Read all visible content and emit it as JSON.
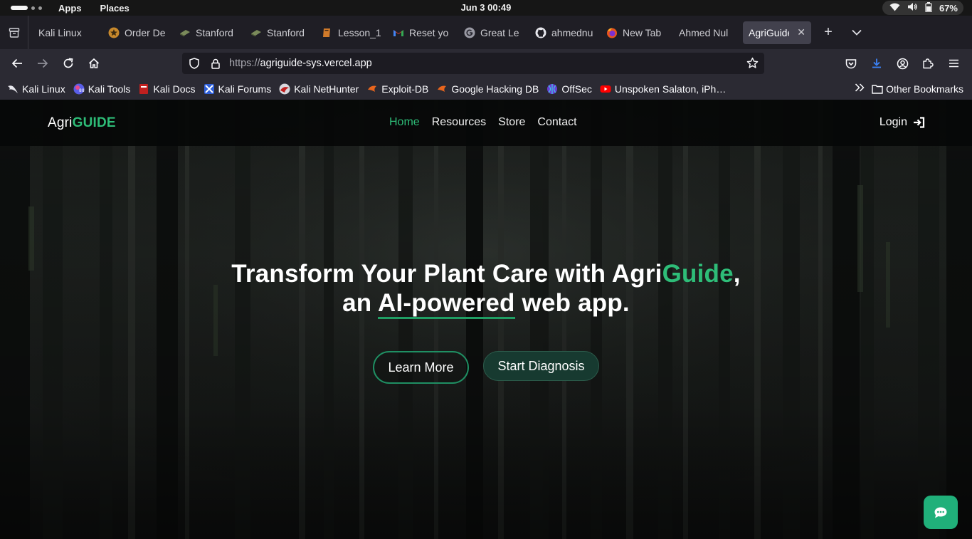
{
  "topbar": {
    "apps_label": "Apps",
    "places_label": "Places",
    "clock": "Jun 3  00:49",
    "battery_percent": "67%"
  },
  "tabs": [
    {
      "title": "Kali Linux",
      "icon": "none"
    },
    {
      "title": "Order De",
      "icon": "star-badge-icon"
    },
    {
      "title": "Stanford",
      "icon": "stanford-icon"
    },
    {
      "title": "Stanford",
      "icon": "stanford-icon"
    },
    {
      "title": "Lesson_1",
      "icon": "book-icon"
    },
    {
      "title": "Reset yo",
      "icon": "gmail-icon"
    },
    {
      "title": "Great Le",
      "icon": "google-icon"
    },
    {
      "title": "ahmednu",
      "icon": "github-icon"
    },
    {
      "title": "New Tab",
      "icon": "firefox-icon"
    },
    {
      "title": "Ahmed Nul",
      "icon": "none"
    },
    {
      "title": "AgriGuide",
      "icon": "none",
      "active": true
    }
  ],
  "urlbar": {
    "scheme": "https://",
    "host_path": "agriguide-sys.vercel.app"
  },
  "bookmarks": {
    "items": [
      {
        "label": "Kali Linux",
        "icon": "kali-dragon-icon"
      },
      {
        "label": "Kali Tools",
        "icon": "kali-tools-icon"
      },
      {
        "label": "Kali Docs",
        "icon": "kali-docs-icon"
      },
      {
        "label": "Kali Forums",
        "icon": "kali-forums-icon"
      },
      {
        "label": "Kali NetHunter",
        "icon": "nethunter-icon"
      },
      {
        "label": "Exploit-DB",
        "icon": "exploit-db-icon"
      },
      {
        "label": "Google Hacking DB",
        "icon": "ghdb-icon"
      },
      {
        "label": "OffSec",
        "icon": "offsec-icon"
      },
      {
        "label": "Unspoken Salaton, iPh…",
        "icon": "youtube-icon"
      }
    ],
    "other_label": "Other Bookmarks"
  },
  "site": {
    "logo_plain": "Agri",
    "logo_accent": "GUIDE",
    "nav": [
      "Home",
      "Resources",
      "Store",
      "Contact"
    ],
    "active_nav": "Home",
    "login_label": "Login",
    "accent_color": "#2ebd78"
  },
  "hero": {
    "line1_pre": "Transform Your Plant Care with Agri",
    "line1_accent": "Guide",
    "line1_post": ",",
    "line2_pre": "an ",
    "line2_u1": "AI-",
    "line2_u2": "powered",
    "line2_post": " web app.",
    "learn_more_label": "Learn More",
    "start_diagnosis_label": "Start Diagnosis"
  },
  "chat_button": {
    "icon": "chat-bubble-icon"
  }
}
